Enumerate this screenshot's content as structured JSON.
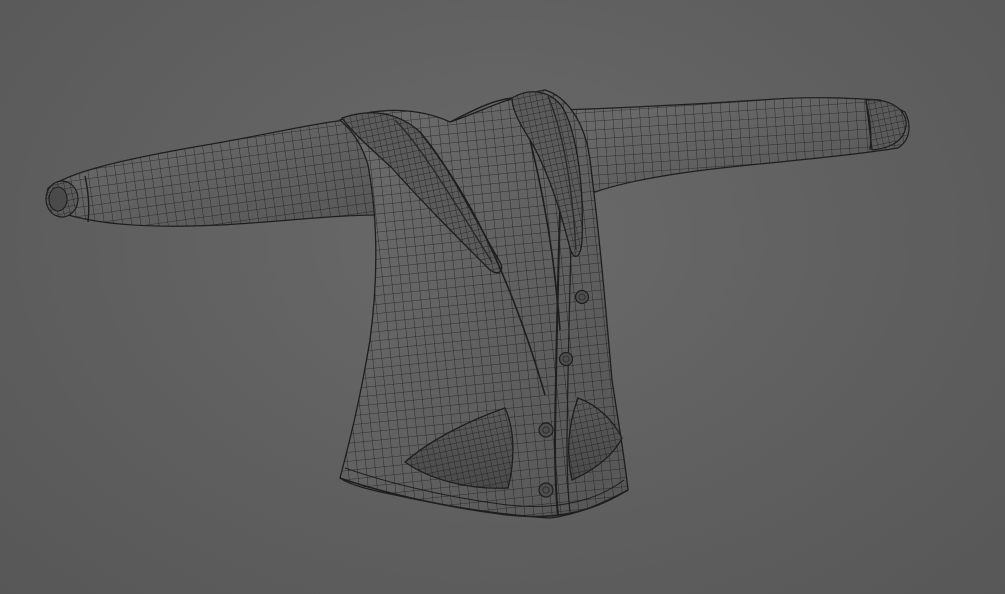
{
  "viewport": {
    "background_color": "#636363",
    "mesh_fill_color": "#5e5e5e",
    "wire_color": "#1e1e1e",
    "shade_color": "#7a7a7a",
    "render_mode": "wireframe"
  },
  "model": {
    "subject": "jacket-mesh",
    "buttons": 4,
    "pockets": 2,
    "lapels": 2,
    "sleeves": 2
  }
}
